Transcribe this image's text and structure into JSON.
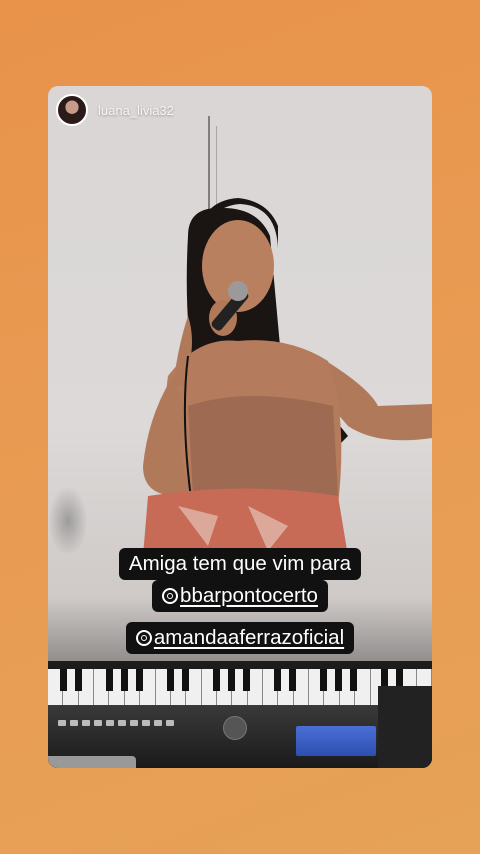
{
  "story": {
    "username": "luana_livia32",
    "caption_line1": "Amiga tem que vim para",
    "mention1": "bbarpontocerto",
    "mention2": "amandaaferrazoficial"
  },
  "colors": {
    "background_top": "#e8924a",
    "background_bottom": "#e6a257",
    "caption_bg": "#111111",
    "caption_text": "#ffffff"
  },
  "icons": {
    "avatar": "profile-avatar",
    "mention": "mention-icon"
  }
}
